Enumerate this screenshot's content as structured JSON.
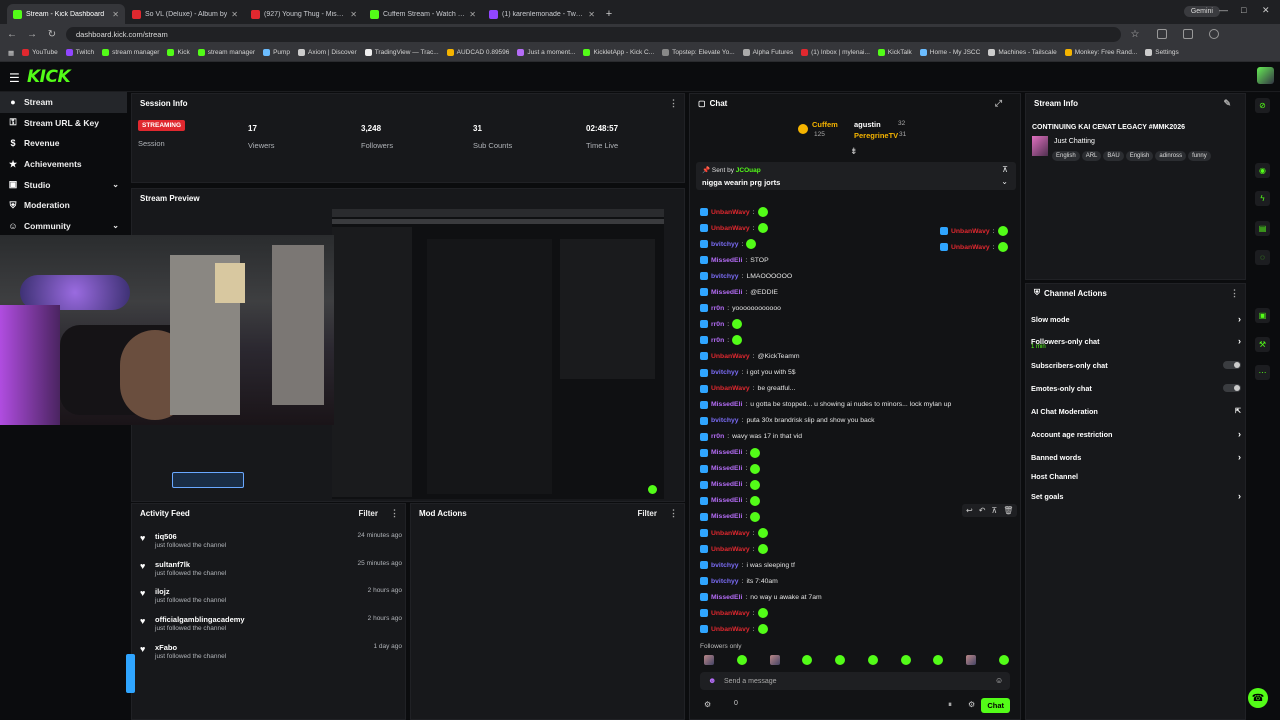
{
  "browser": {
    "tabs": [
      {
        "title": "Stream - Kick Dashboard",
        "color": "#53fc18",
        "active": true
      },
      {
        "title": "So VL (Deluxe) - Album by",
        "color": "#e0282f"
      },
      {
        "title": "(927) Young Thug - Miss M",
        "color": "#e0282f"
      },
      {
        "title": "Cuffem Stream - Watch Live o",
        "color": "#53fc18"
      },
      {
        "title": "(1) karenlemonade - Twitch",
        "color": "#9146ff"
      }
    ],
    "new_tab": "+",
    "gemini": "Gemini",
    "url": "dashboard.kick.com/stream",
    "bookmarks": [
      "YouTube",
      "Twitch",
      "stream manager",
      "Kick",
      "stream manager",
      "Pump",
      "Axiom | Discover",
      "TradingView — Trac...",
      "AUDCAD 0.89596",
      "Just a moment...",
      "KickletApp - Kick C...",
      "Topstep: Elevate Yo...",
      "Alpha Futures",
      "(1) Inbox | mylenai...",
      "KickTalk",
      "Home - My JSCC",
      "Machines - Tailscale",
      "Monkey: Free Rand...",
      "Settings"
    ]
  },
  "app": {
    "logo": "KICK"
  },
  "sidebar": {
    "items": [
      {
        "label": "Stream",
        "active": true,
        "icon": "●"
      },
      {
        "label": "Stream URL & Key",
        "icon": "⚿"
      },
      {
        "label": "Revenue",
        "icon": "$"
      },
      {
        "label": "Achievements",
        "icon": "★"
      },
      {
        "label": "Studio",
        "icon": "▣",
        "chev": true
      },
      {
        "label": "Moderation",
        "icon": "⛨"
      },
      {
        "label": "Community",
        "icon": "☺",
        "chev": true
      }
    ]
  },
  "session": {
    "title": "Session Info",
    "badge": "STREAMING",
    "session_label": "Session",
    "stats": [
      {
        "value": "17",
        "label": "Viewers"
      },
      {
        "value": "3,248",
        "label": "Followers"
      },
      {
        "value": "31",
        "label": "Sub Counts"
      },
      {
        "value": "02:48:57",
        "label": "Time Live"
      }
    ]
  },
  "preview": {
    "title": "Stream Preview"
  },
  "activity": {
    "title": "Activity Feed",
    "filter": "Filter",
    "items": [
      {
        "name": "tiq506",
        "desc": "just followed the channel",
        "time": "24 minutes ago"
      },
      {
        "name": "sultanf7lk",
        "desc": "just followed the channel",
        "time": "25 minutes ago"
      },
      {
        "name": "ilojz",
        "desc": "just followed the channel",
        "time": "2 hours ago"
      },
      {
        "name": "officialgamblingacademy",
        "desc": "just followed the channel",
        "time": "2 hours ago"
      },
      {
        "name": "xFabo",
        "desc": "just followed the channel",
        "time": "1 day ago"
      }
    ]
  },
  "mod": {
    "title": "Mod Actions",
    "filter": "Filter"
  },
  "chat": {
    "title": "Chat",
    "top": {
      "leader": "Cuffem",
      "leader_count": "125",
      "u1": "agustin",
      "u1c": "32",
      "u2": "PeregrineTV",
      "u2c": "31"
    },
    "pinned": {
      "sent_by": "Sent by",
      "user": "JCOuap",
      "text": "nigga wearin prg jorts"
    },
    "messages": [
      {
        "user": "UnbanWavy",
        "color": "#e0282f",
        "text": "",
        "emote": true
      },
      {
        "user": "UnbanWavy",
        "color": "#e0282f",
        "text": "",
        "emote": true
      },
      {
        "user": "bvitchyy",
        "color": "#7b6cf6",
        "text": "",
        "emote": true
      },
      {
        "user": "MissedEli",
        "color": "#b46cf6",
        "text": "STOP"
      },
      {
        "user": "bvitchyy",
        "color": "#7b6cf6",
        "text": "LMAOOOOOO"
      },
      {
        "user": "MissedEli",
        "color": "#b46cf6",
        "text": "@EDDIE"
      },
      {
        "user": "rr0n",
        "color": "#b46cf6",
        "text": "yoooooooooooo"
      },
      {
        "user": "rr0n",
        "color": "#b46cf6",
        "text": "",
        "emote": true
      },
      {
        "user": "rr0n",
        "color": "#b46cf6",
        "text": "",
        "emote": true
      },
      {
        "user": "UnbanWavy",
        "color": "#e0282f",
        "text": "@KickTeamm"
      },
      {
        "user": "bvitchyy",
        "color": "#7b6cf6",
        "text": "i got you with 5$"
      },
      {
        "user": "UnbanWavy",
        "color": "#e0282f",
        "text": "be greatful..."
      },
      {
        "user": "MissedEli",
        "color": "#b46cf6",
        "text": "u gotta be stopped... u showing ai nudes to minors... lock mylan up"
      },
      {
        "user": "bvitchyy",
        "color": "#7b6cf6",
        "text": "puta 30x brandrisk slip and show you back"
      },
      {
        "user": "rr0n",
        "color": "#b46cf6",
        "text": "wavy was 17 in that vid"
      },
      {
        "user": "MissedEli",
        "color": "#b46cf6",
        "text": "",
        "emote": true
      },
      {
        "user": "MissedEli",
        "color": "#b46cf6",
        "text": "",
        "emote": true
      },
      {
        "user": "MissedEli",
        "color": "#b46cf6",
        "text": "",
        "emote": true
      },
      {
        "user": "MissedEli",
        "color": "#b46cf6",
        "text": "",
        "emote": true
      },
      {
        "user": "MissedEli",
        "color": "#b46cf6",
        "text": "",
        "emote": true
      },
      {
        "user": "UnbanWavy",
        "color": "#e0282f",
        "text": "",
        "emote": true
      },
      {
        "user": "UnbanWavy",
        "color": "#e0282f",
        "text": "",
        "emote": true
      },
      {
        "user": "bvitchyy",
        "color": "#7b6cf6",
        "text": "i was sleeping tf"
      },
      {
        "user": "bvitchyy",
        "color": "#7b6cf6",
        "text": "its 7:40am"
      },
      {
        "user": "MissedEli",
        "color": "#b46cf6",
        "text": "no way u awake at 7am"
      },
      {
        "user": "UnbanWavy",
        "color": "#e0282f",
        "text": "",
        "emote": true
      },
      {
        "user": "UnbanWavy",
        "color": "#e0282f",
        "text": "",
        "emote": true
      }
    ],
    "side_users": [
      "UnbanWavy",
      "UnbanWavy"
    ],
    "followers_only": "Followers only",
    "placeholder": "Send a message",
    "count": "0",
    "send": "Chat"
  },
  "stream_info": {
    "title": "Stream Info",
    "stream_title": "CONTINUING KAI CENAT LEGACY #MMK2026",
    "category": "Just Chatting",
    "tags": [
      "English",
      "ARL",
      "BAU",
      "English",
      "adinross",
      "funny"
    ]
  },
  "channel_actions": {
    "title": "Channel Actions",
    "items": [
      {
        "label": "Slow mode",
        "ctl": "arrow"
      },
      {
        "label": "Followers-only chat",
        "ctl": "arrow",
        "sub": "1 min"
      },
      {
        "label": "Subscribers-only chat",
        "ctl": "toggle"
      },
      {
        "label": "Emotes-only chat",
        "ctl": "toggle"
      },
      {
        "label": "AI Chat Moderation",
        "ctl": "ext"
      },
      {
        "label": "Account age restriction",
        "ctl": "arrow"
      },
      {
        "label": "Banned words",
        "ctl": "arrow"
      },
      {
        "label": "Host Channel",
        "ctl": "none"
      },
      {
        "label": "Set goals",
        "ctl": "arrow"
      }
    ]
  },
  "colors": {
    "accent": "#53fc18",
    "live": "#e0282f"
  }
}
